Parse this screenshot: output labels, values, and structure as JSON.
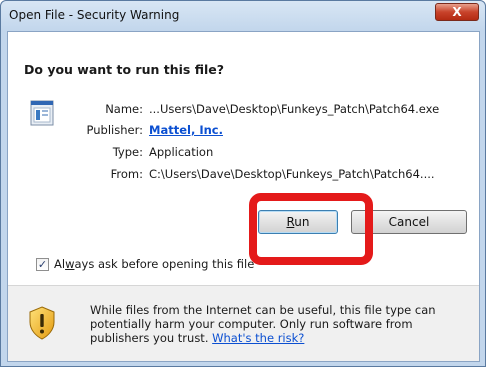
{
  "window": {
    "title": "Open File - Security Warning",
    "close_label": "X"
  },
  "dialog": {
    "question": "Do you want to run this file?",
    "details": [
      {
        "label": "Name:",
        "value": "...Users\\Dave\\Desktop\\Funkeys_Patch\\Patch64.exe",
        "is_link": false
      },
      {
        "label": "Publisher:",
        "value": "Mattel, Inc.",
        "is_link": true
      },
      {
        "label": "Type:",
        "value": "Application",
        "is_link": false
      },
      {
        "label": "From:",
        "value": "C:\\Users\\Dave\\Desktop\\Funkeys_Patch\\Patch64....",
        "is_link": false
      }
    ],
    "buttons": {
      "run_access_key": "R",
      "run_rest": "un",
      "cancel_label": "Cancel"
    },
    "checkbox": {
      "checked": true,
      "check_mark": "✓",
      "label_before": "Al",
      "label_access_key": "w",
      "label_after": "ays ask before opening this file"
    },
    "warning": {
      "text": "While files from the Internet can be useful, this file type can potentially harm your computer. Only run software from publishers you trust.",
      "link": "What's the risk?"
    }
  },
  "colors": {
    "highlight": "#e41a1a",
    "link": "#0b4fd1"
  },
  "icons": [
    "application-icon",
    "shield-warning-icon",
    "close-icon",
    "check-icon"
  ]
}
